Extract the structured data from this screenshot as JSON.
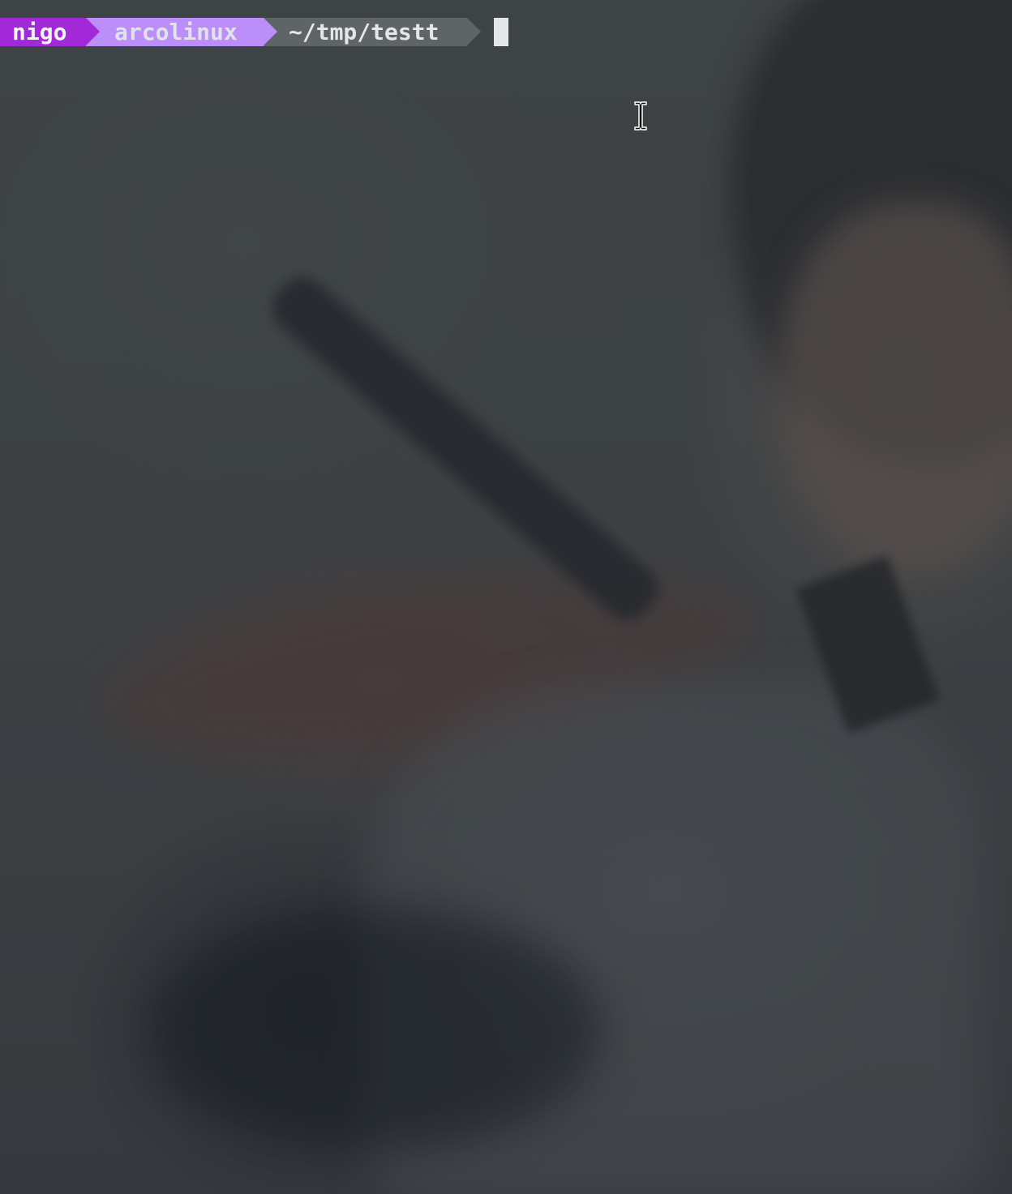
{
  "prompt": {
    "user": "nigo",
    "host": "arcolinux",
    "path": "~/tmp/testt"
  },
  "colors": {
    "user_segment": "#a129d7",
    "host_segment": "#bb8efa",
    "path_segment": "#5f6467",
    "cursor": "#e4e6ea"
  },
  "icons": {
    "mouse_pointer": "text-ibeam-icon"
  }
}
